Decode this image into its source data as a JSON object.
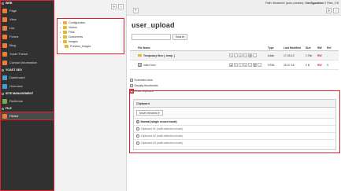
{
  "module_menu": {
    "groups": [
      {
        "label": "WEB",
        "items": [
          {
            "label": "Page",
            "color": "#e8803a"
          },
          {
            "label": "View",
            "color": "#e8803a"
          },
          {
            "label": "List",
            "color": "#e8803a"
          },
          {
            "label": "Forms",
            "color": "#e8803a"
          },
          {
            "label": "Blog",
            "color": "#e8803a"
          },
          {
            "label": "Yoast Theme",
            "color": "#e8803a"
          },
          {
            "label": "Contact Information",
            "color": "#e8803a"
          }
        ]
      },
      {
        "label": "YOAST SEO",
        "items": [
          {
            "label": "Dashboard",
            "color": "#44a1cf"
          },
          {
            "label": "Overview",
            "color": "#44a1cf"
          }
        ]
      },
      {
        "label": "SITE MANAGEMENT",
        "items": [
          {
            "label": "Redirects",
            "color": "#6cb24a"
          }
        ]
      },
      {
        "label": "FILE",
        "items": [
          {
            "label": "Filelist",
            "color": "#e8803a"
          }
        ]
      }
    ]
  },
  "toolbar": {
    "path_label": "Path:",
    "path_value": "fileadmin/ (auto-created):",
    "path_folder": "Configuration",
    "path_count": "2 Files, 0 B",
    "refresh_glyph": "⟳",
    "help_glyph": "?",
    "upload_glyph": "⤒",
    "tree_refresh_glyph": "⟳",
    "tree_help_glyph": "?"
  },
  "tree": {
    "nodes": [
      {
        "label": "Configuration",
        "depth": 0
      },
      {
        "label": "Videos",
        "depth": 0
      },
      {
        "label": "Files",
        "depth": 0
      },
      {
        "label": "Documents",
        "depth": 0
      },
      {
        "label": "Images",
        "depth": 0
      },
      {
        "label": "Preview_images",
        "depth": 1
      }
    ]
  },
  "main": {
    "title": "user_upload",
    "search_button": "Search",
    "columns": {
      "name": "File Name",
      "type": "Type",
      "modified": "Last Modified",
      "size": "Size",
      "rw": "RW",
      "ref": "Ref"
    },
    "rows": [
      {
        "name": "Temporary files (_temp_)",
        "type": "folder",
        "modified": "17-05-19",
        "size": "1 File",
        "rw": "RW",
        "ref": "-"
      },
      {
        "name": "index.html",
        "type": "HTML",
        "modified": "25-07-18",
        "size": "0 B",
        "rw": "RW",
        "ref": "0"
      }
    ],
    "options": {
      "extended_view": "Extended view",
      "display_thumbnails": "Display thumbnails",
      "show_clipboard": "Show clipboard"
    }
  },
  "clipboard": {
    "heading": "Clipboard",
    "move_elements": "Move elements",
    "pads": [
      {
        "label": "Normal (single record mode)",
        "selected": true
      },
      {
        "label": "Clipboard #1 (multi-selection mode)",
        "selected": false
      },
      {
        "label": "Clipboard #2 (multi-selection mode)",
        "selected": false
      },
      {
        "label": "Clipboard #3 (multi-selection mode)",
        "selected": false
      }
    ]
  },
  "colors": {
    "highlight": "#e0202a",
    "sidebar_bg": "#313131",
    "folder": "#e8b631"
  }
}
